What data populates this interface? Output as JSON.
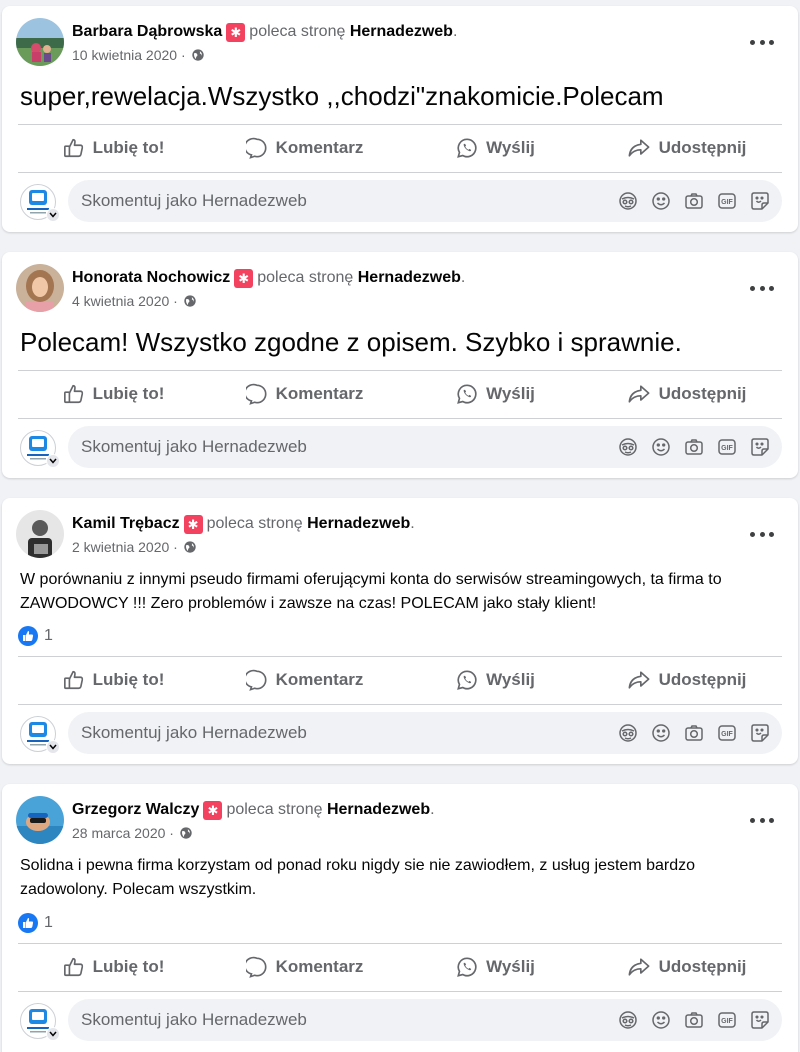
{
  "action_labels": {
    "like": "Lubię to!",
    "comment": "Komentarz",
    "send": "Wyślij",
    "share": "Udostępnij"
  },
  "comment_placeholder": "Skomentuj jako Hernadezweb",
  "posts": [
    {
      "author": "Barbara Dąbrowska",
      "recommends": "poleca stronę",
      "page": "Hernadezweb",
      "date": "10 kwietnia 2020",
      "text": "super,rewelacja.Wszystko ,,chodzi\"znakomicie.Polecam",
      "text_size": "large"
    },
    {
      "author": "Honorata Nochowicz",
      "recommends": "poleca stronę",
      "page": "Hernadezweb",
      "date": "4 kwietnia 2020",
      "text": "Polecam! Wszystko zgodne z opisem. Szybko i sprawnie.",
      "text_size": "large"
    },
    {
      "author": "Kamil Trębacz",
      "recommends": "poleca stronę",
      "page": "Hernadezweb",
      "date": "2 kwietnia 2020",
      "text": "W porównaniu z innymi pseudo firmami oferującymi konta do serwisów streamingowych, ta firma to ZAWODOWCY !!! Zero problemów i zawsze na czas! POLECAM jako stały klient!",
      "text_size": "normal",
      "reactions": "1"
    },
    {
      "author": "Grzegorz Walczy",
      "recommends": "poleca stronę",
      "page": "Hernadezweb",
      "date": "28 marca 2020",
      "text": "Solidna i pewna firma korzystam od ponad roku nigdy sie nie zawiodłem,  z usług jestem bardzo zadowolony. Polecam wszystkim.",
      "text_size": "normal",
      "reactions": "1"
    }
  ]
}
